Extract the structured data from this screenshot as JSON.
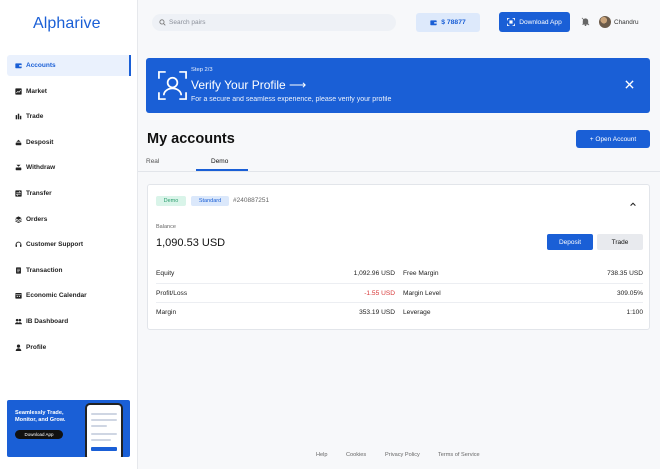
{
  "app": {
    "logo": "Alpharive"
  },
  "sidebar": {
    "items": [
      {
        "label": "Accounts",
        "icon": "wallet-icon",
        "active": true
      },
      {
        "label": "Market",
        "icon": "chart-icon"
      },
      {
        "label": "Trade",
        "icon": "trade-icon"
      },
      {
        "label": "Desposit",
        "icon": "deposit-icon"
      },
      {
        "label": "Withdraw",
        "icon": "withdraw-icon"
      },
      {
        "label": "Transfer",
        "icon": "transfer-icon"
      },
      {
        "label": "Orders",
        "icon": "orders-icon"
      },
      {
        "label": "Customer Support",
        "icon": "headset-icon"
      },
      {
        "label": "Transaction",
        "icon": "transaction-icon"
      },
      {
        "label": "Economic Calendar",
        "icon": "calendar-icon"
      },
      {
        "label": "IB Dashboard",
        "icon": "group-icon"
      },
      {
        "label": "Profile",
        "icon": "user-icon"
      }
    ],
    "promo": {
      "text": "Seamlessly Trade, Monitor, and Grow.",
      "button": "Download App"
    }
  },
  "header": {
    "search_placeholder": "Search pairs",
    "balance": "$ 78877",
    "download_label": "Download App",
    "user_name": "Chandru"
  },
  "banner": {
    "step": "Step 2/3",
    "title": "Verify Your Profile ⟶",
    "subtitle": "For a secure and seamless experience, please verify your profile"
  },
  "accounts": {
    "title": "My accounts",
    "open_label": "+ Open Account",
    "tabs": [
      "Real",
      "Demo"
    ],
    "active_tab": "Demo"
  },
  "card": {
    "badges": [
      "Demo",
      "Standard"
    ],
    "account_id": "#240887251",
    "balance_label": "Balance",
    "balance_value": "1,090.53 USD",
    "deposit_label": "Deposit",
    "trade_label": "Trade",
    "rows": [
      {
        "l1": "Equity",
        "v1": "1,092.96 USD",
        "l2": "Free Margin",
        "v2": "738.35 USD"
      },
      {
        "l1": "Profit/Loss",
        "v1": "-1.55 USD",
        "l2": "Margin Level",
        "v2": "309.05%"
      },
      {
        "l1": "Margin",
        "v1": "353.19 USD",
        "l2": "Leverage",
        "v2": "1:100"
      }
    ]
  },
  "footer": {
    "links": [
      "Help",
      "Cookies",
      "Privacy Policy",
      "Terms of Service"
    ]
  },
  "colors": {
    "accent": "#1a5fd6",
    "negative": "#d83a3a",
    "demo_badge": "#2a9d6d"
  }
}
